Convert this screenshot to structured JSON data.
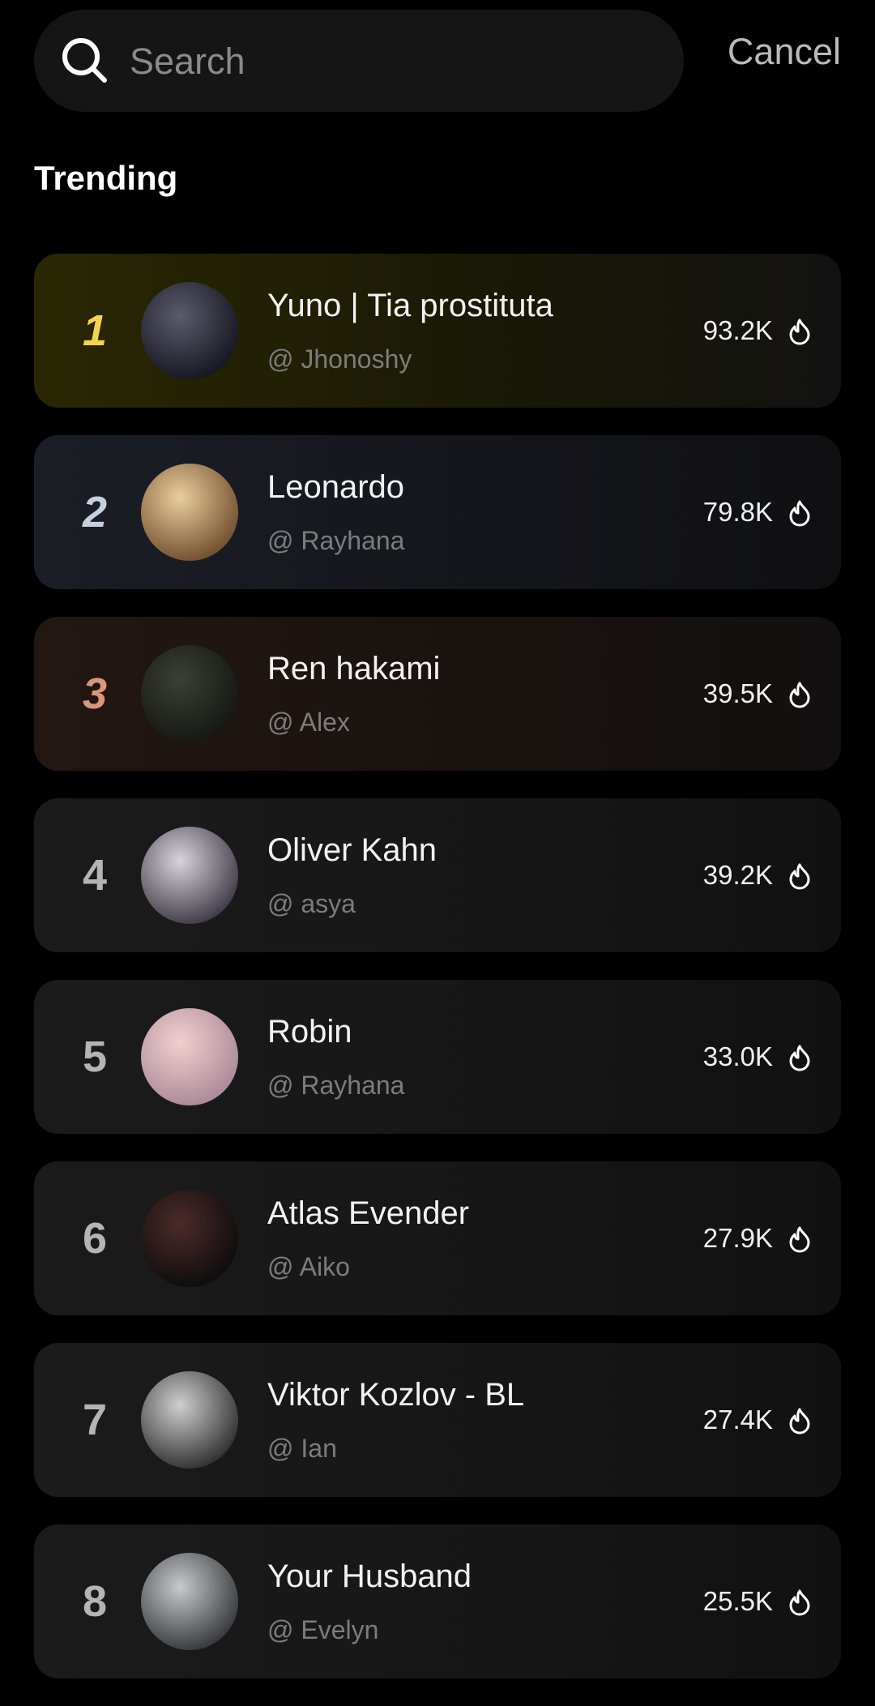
{
  "search": {
    "placeholder": "Search",
    "value": ""
  },
  "cancel_label": "Cancel",
  "section_title": "Trending",
  "items": [
    {
      "rank": "1",
      "name": "Yuno | Tia prostituta",
      "handle": "@ Jhonoshy",
      "count": "93.2K",
      "avatar": [
        "#5b5b6a",
        "#141420"
      ]
    },
    {
      "rank": "2",
      "name": "Leonardo",
      "handle": "@ Rayhana",
      "count": "79.8K",
      "avatar": [
        "#e9cf9c",
        "#6b4a2a"
      ]
    },
    {
      "rank": "3",
      "name": "Ren hakami",
      "handle": "@ Alex",
      "count": "39.5K",
      "avatar": [
        "#3b3f34",
        "#141612"
      ]
    },
    {
      "rank": "4",
      "name": "Oliver Kahn",
      "handle": "@ asya",
      "count": "39.2K",
      "avatar": [
        "#d7d4dc",
        "#3a3440"
      ]
    },
    {
      "rank": "5",
      "name": "Robin",
      "handle": "@ Rayhana",
      "count": "33.0K",
      "avatar": [
        "#f1cfcf",
        "#a88796"
      ]
    },
    {
      "rank": "6",
      "name": "Atlas Evender",
      "handle": "@ Aiko",
      "count": "27.9K",
      "avatar": [
        "#4d2a2a",
        "#0b0b0b"
      ]
    },
    {
      "rank": "7",
      "name": "Viktor Kozlov - BL",
      "handle": "@ Ian",
      "count": "27.4K",
      "avatar": [
        "#cfcfcf",
        "#2a2a2a"
      ]
    },
    {
      "rank": "8",
      "name": "Your Husband",
      "handle": "@ Evelyn",
      "count": "25.5K",
      "avatar": [
        "#c7c9cc",
        "#303236"
      ]
    }
  ]
}
